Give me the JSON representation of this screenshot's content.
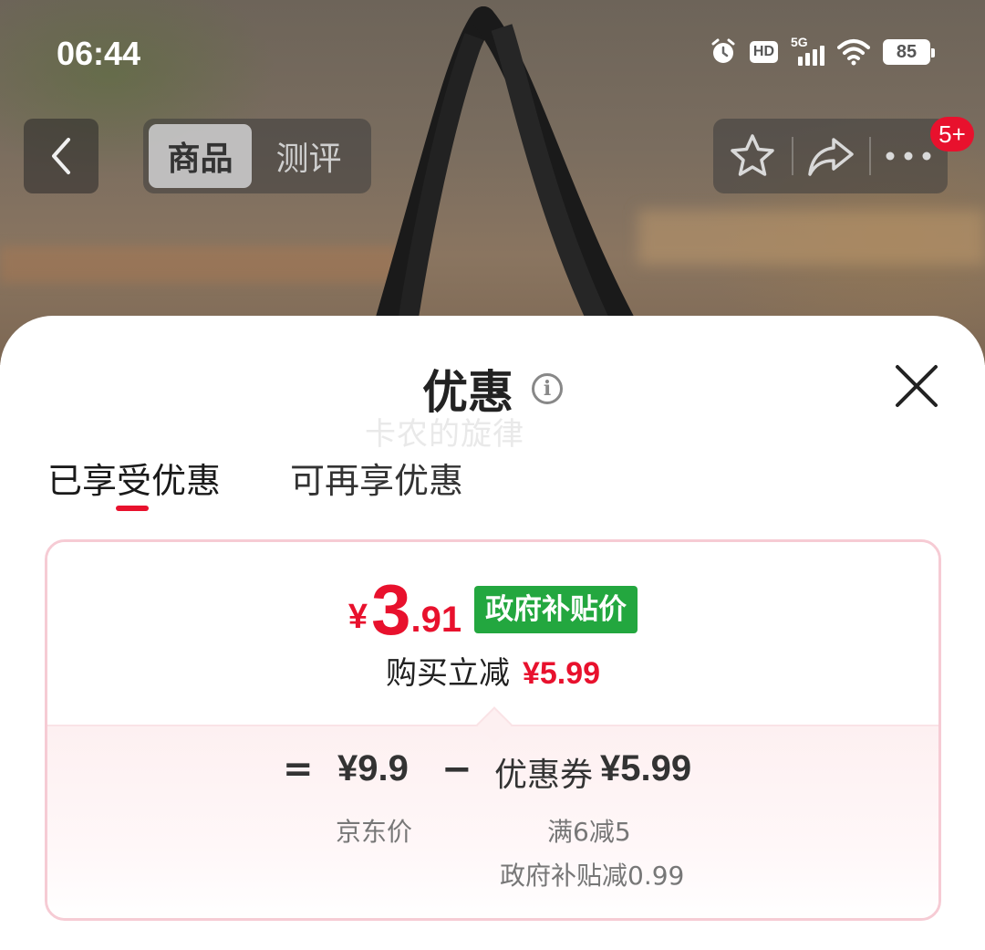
{
  "status_bar": {
    "time": "06:44",
    "network": "5G",
    "hd": "HD",
    "battery": "85",
    "icons": [
      "alarm-icon",
      "hd-icon",
      "signal-icon",
      "wifi-icon",
      "battery-icon"
    ]
  },
  "nav": {
    "back_icon": "chevron-left-icon",
    "tabs": [
      {
        "label": "商品",
        "active": true
      },
      {
        "label": "测评",
        "active": false
      }
    ],
    "actions": [
      "star-icon",
      "share-icon",
      "more-icon"
    ],
    "badge": "5+"
  },
  "sheet": {
    "title": "优惠",
    "info_icon": "info-icon",
    "close_icon": "close-icon",
    "watermark": "卡农的旋律",
    "tabs": [
      {
        "label": "已享受优惠",
        "active": true
      },
      {
        "label": "可再享优惠",
        "active": false
      }
    ],
    "price": {
      "currency": "¥",
      "integer": "3",
      "decimal": ".91",
      "tag": "政府补贴价",
      "reduce_label": "购买立减",
      "reduce_amount": "¥5.99"
    },
    "formula": {
      "equals": "=",
      "base_price": "¥9.9",
      "base_label": "京东价",
      "minus": "−",
      "coupon_label": "优惠券",
      "coupon_amount": "¥5.99",
      "details": [
        "满6减5",
        "政府补贴减0.99"
      ]
    }
  },
  "colors": {
    "accent_red": "#e8112d",
    "subsidy_green": "#23a73f",
    "card_border": "#f6cbd4"
  }
}
